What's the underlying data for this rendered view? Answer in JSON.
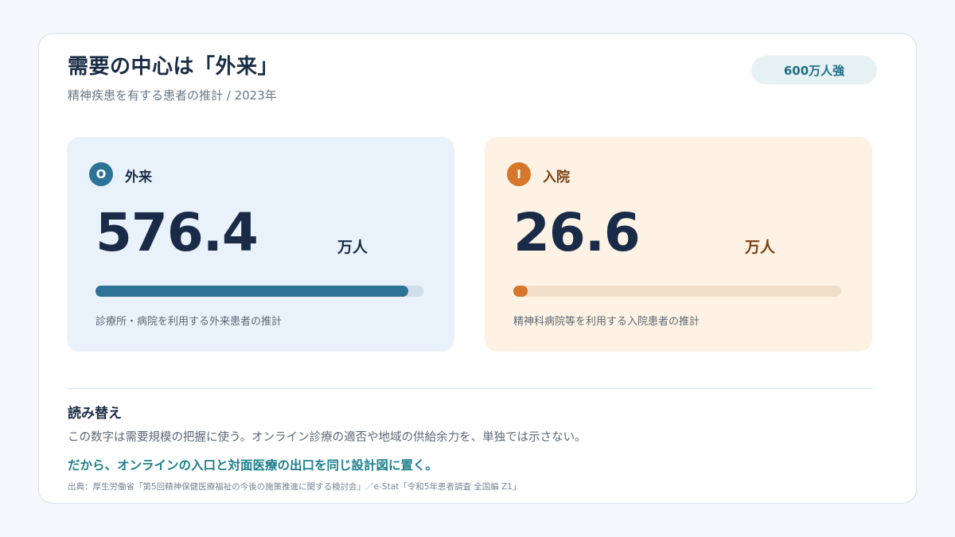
{
  "header": {
    "title": "需要の中心は「外来」",
    "subtitle": "精神疾患を有する患者の推計 / 2023年",
    "badge": "600万人強"
  },
  "panels": {
    "outpatient": {
      "icon_letter": "O",
      "icon_name": "outpatient-icon",
      "label": "外来",
      "value": "576.4",
      "unit": "万人",
      "bar_fraction": 0.955,
      "note": "診療所・病院を利用する外来患者の推計",
      "color": "#2c7396"
    },
    "inpatient": {
      "icon_letter": "I",
      "icon_name": "inpatient-icon",
      "label": "入院",
      "value": "26.6",
      "unit": "万人",
      "bar_fraction": 0.044,
      "note": "精神科病院等を利用する入院患者の推計",
      "color": "#d7772b"
    }
  },
  "reading": {
    "title": "読み替え",
    "body": "この数字は需要規模の把握に使う。オンライン診療の適否や地域の供給余力を、単独では示さない。",
    "key_message": "だから、オンラインの入口と対面医療の出口を同じ設計図に置く。"
  },
  "source": "出典：厚生労働省「第5回精神保健医療福祉の今後の施策推進に関する検討会」／e-Stat「令和5年患者調査 全国編 Z1」"
}
